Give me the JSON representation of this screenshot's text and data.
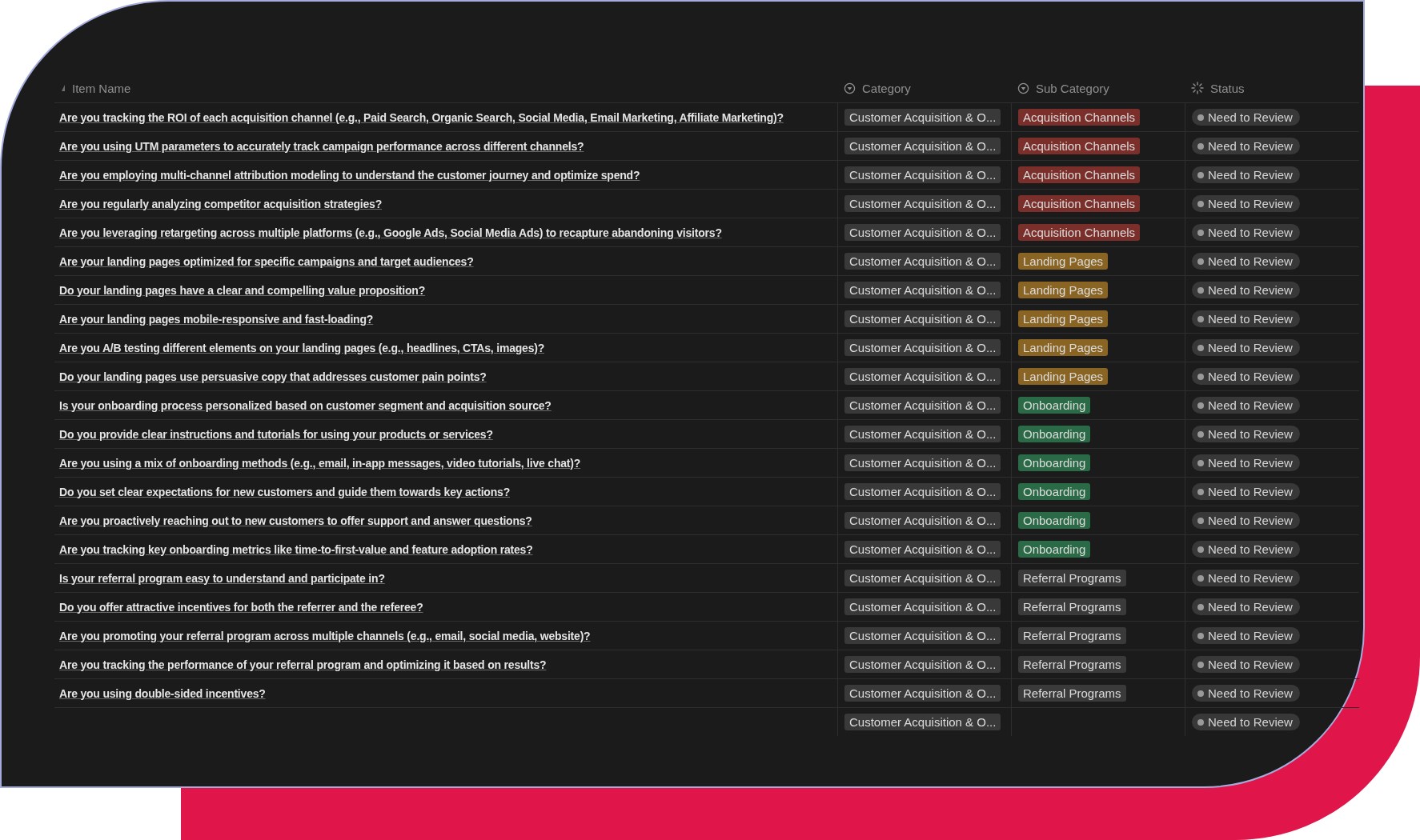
{
  "table": {
    "columns": [
      {
        "label": "Item Name",
        "kind": "title"
      },
      {
        "label": "Category",
        "kind": "select"
      },
      {
        "label": "Sub Category",
        "kind": "select"
      },
      {
        "label": "Status",
        "kind": "status"
      }
    ],
    "rows": [
      {
        "name": "Are you tracking the ROI of each acquisition channel (e.g., Paid Search, Organic Search, Social Media, Email Marketing, Affiliate Marketing)?",
        "category": "Customer Acquisition & O...",
        "sub_category": {
          "label": "Acquisition Channels",
          "color": "#7b2f2b"
        },
        "status": "Need to Review"
      },
      {
        "name": "Are you using UTM parameters to accurately track campaign performance across different channels?",
        "category": "Customer Acquisition & O...",
        "sub_category": {
          "label": "Acquisition Channels",
          "color": "#7b2f2b"
        },
        "status": "Need to Review"
      },
      {
        "name": "Are you employing multi-channel attribution modeling to understand the customer journey and optimize spend?",
        "category": "Customer Acquisition & O...",
        "sub_category": {
          "label": "Acquisition Channels",
          "color": "#7b2f2b"
        },
        "status": "Need to Review"
      },
      {
        "name": "Are you regularly analyzing competitor acquisition strategies?",
        "category": "Customer Acquisition & O...",
        "sub_category": {
          "label": "Acquisition Channels",
          "color": "#7b2f2b"
        },
        "status": "Need to Review"
      },
      {
        "name": "Are you leveraging retargeting across multiple platforms (e.g., Google Ads, Social Media Ads) to recapture abandoning visitors?",
        "category": "Customer Acquisition & O...",
        "sub_category": {
          "label": "Acquisition Channels",
          "color": "#7b2f2b"
        },
        "status": "Need to Review"
      },
      {
        "name": "Are your landing pages optimized for specific campaigns and target audiences?",
        "category": "Customer Acquisition & O...",
        "sub_category": {
          "label": "Landing Pages",
          "color": "#8a6422"
        },
        "status": "Need to Review"
      },
      {
        "name": "Do your landing pages have a clear and compelling value proposition?",
        "category": "Customer Acquisition & O...",
        "sub_category": {
          "label": "Landing Pages",
          "color": "#8a6422"
        },
        "status": "Need to Review"
      },
      {
        "name": "Are your landing pages mobile-responsive and fast-loading?",
        "category": "Customer Acquisition & O...",
        "sub_category": {
          "label": "Landing Pages",
          "color": "#8a6422"
        },
        "status": "Need to Review"
      },
      {
        "name": "Are you A/B testing different elements on your landing pages (e.g., headlines, CTAs, images)?",
        "category": "Customer Acquisition & O...",
        "sub_category": {
          "label": "Landing Pages",
          "color": "#8a6422"
        },
        "status": "Need to Review"
      },
      {
        "name": "Do your landing pages use persuasive copy that addresses customer pain points?",
        "category": "Customer Acquisition & O...",
        "sub_category": {
          "label": "Landing Pages",
          "color": "#8a6422"
        },
        "status": "Need to Review"
      },
      {
        "name": "Is your onboarding process personalized based on customer segment and acquisition source?",
        "category": "Customer Acquisition & O...",
        "sub_category": {
          "label": "Onboarding",
          "color": "#2b6a46"
        },
        "status": "Need to Review"
      },
      {
        "name": "Do you provide clear instructions and tutorials for using your products or services?",
        "category": "Customer Acquisition & O...",
        "sub_category": {
          "label": "Onboarding",
          "color": "#2b6a46"
        },
        "status": "Need to Review"
      },
      {
        "name": "Are you using a mix of onboarding methods (e.g., email, in-app messages, video tutorials, live chat)?",
        "category": "Customer Acquisition & O...",
        "sub_category": {
          "label": "Onboarding",
          "color": "#2b6a46"
        },
        "status": "Need to Review"
      },
      {
        "name": "Do you set clear expectations for new customers and guide them towards key actions?",
        "category": "Customer Acquisition & O...",
        "sub_category": {
          "label": "Onboarding",
          "color": "#2b6a46"
        },
        "status": "Need to Review"
      },
      {
        "name": "Are you proactively reaching out to new customers to offer support and answer questions?",
        "category": "Customer Acquisition & O...",
        "sub_category": {
          "label": "Onboarding",
          "color": "#2b6a46"
        },
        "status": "Need to Review"
      },
      {
        "name": "Are you tracking key onboarding metrics like time-to-first-value and feature adoption rates?",
        "category": "Customer Acquisition & O...",
        "sub_category": {
          "label": "Onboarding",
          "color": "#2b6a46"
        },
        "status": "Need to Review"
      },
      {
        "name": "Is your referral program easy to understand and participate in?",
        "category": "Customer Acquisition & O...",
        "sub_category": {
          "label": "Referral Programs",
          "color": "#3a3a3a"
        },
        "status": "Need to Review"
      },
      {
        "name": "Do you offer attractive incentives for both the referrer and the referee?",
        "category": "Customer Acquisition & O...",
        "sub_category": {
          "label": "Referral Programs",
          "color": "#3a3a3a"
        },
        "status": "Need to Review"
      },
      {
        "name": "Are you promoting your referral program across multiple channels (e.g., email, social media, website)?",
        "category": "Customer Acquisition & O...",
        "sub_category": {
          "label": "Referral Programs",
          "color": "#3a3a3a"
        },
        "status": "Need to Review"
      },
      {
        "name": "Are you tracking the performance of your referral program and optimizing it based on results?",
        "category": "Customer Acquisition & O...",
        "sub_category": {
          "label": "Referral Programs",
          "color": "#3a3a3a"
        },
        "status": "Need to Review"
      },
      {
        "name": "Are you using double-sided incentives?",
        "category": "Customer Acquisition & O...",
        "sub_category": {
          "label": "Referral Programs",
          "color": "#3a3a3a"
        },
        "status": "Need to Review"
      },
      {
        "category": "Customer Acquisition & O...",
        "status": "Need to Review"
      }
    ]
  }
}
